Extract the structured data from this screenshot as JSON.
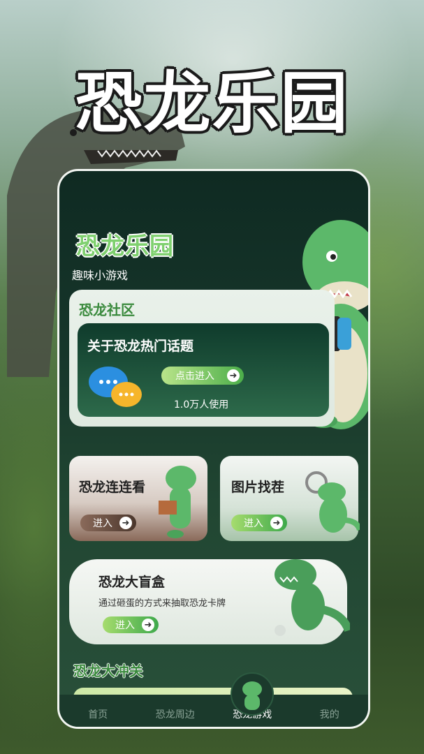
{
  "promo": {
    "title": "恐龙乐园"
  },
  "app": {
    "title": "恐龙乐园",
    "subtitle": "趣味小游戏"
  },
  "community": {
    "label": "恐龙社区",
    "topic_title": "关于恐龙热门话题",
    "enter_label": "点击进入",
    "users_text": "1.0万人使用"
  },
  "games": [
    {
      "title": "恐龙连连看",
      "enter_label": "进入"
    },
    {
      "title": "图片找茬",
      "enter_label": "进入"
    },
    {
      "title": "恐龙大盲盒",
      "desc": "通过砸蛋的方式来抽取恐龙卡牌",
      "enter_label": "进入"
    }
  ],
  "section": {
    "title": "恐龙大冲关"
  },
  "tabbar": [
    {
      "label": "首页",
      "active": false
    },
    {
      "label": "恐龙周边",
      "active": false
    },
    {
      "label": "恐龙游戏",
      "active": true
    },
    {
      "label": "我的",
      "active": false
    }
  ],
  "colors": {
    "accent_green": "#3a8a3d",
    "dark_green": "#0f2a22",
    "light_button": "#8fdc5a"
  },
  "icons": [
    "chat-bubbles-icon",
    "arrow-right-icon",
    "dinosaur-mascot-icon",
    "game-controller-icon"
  ]
}
